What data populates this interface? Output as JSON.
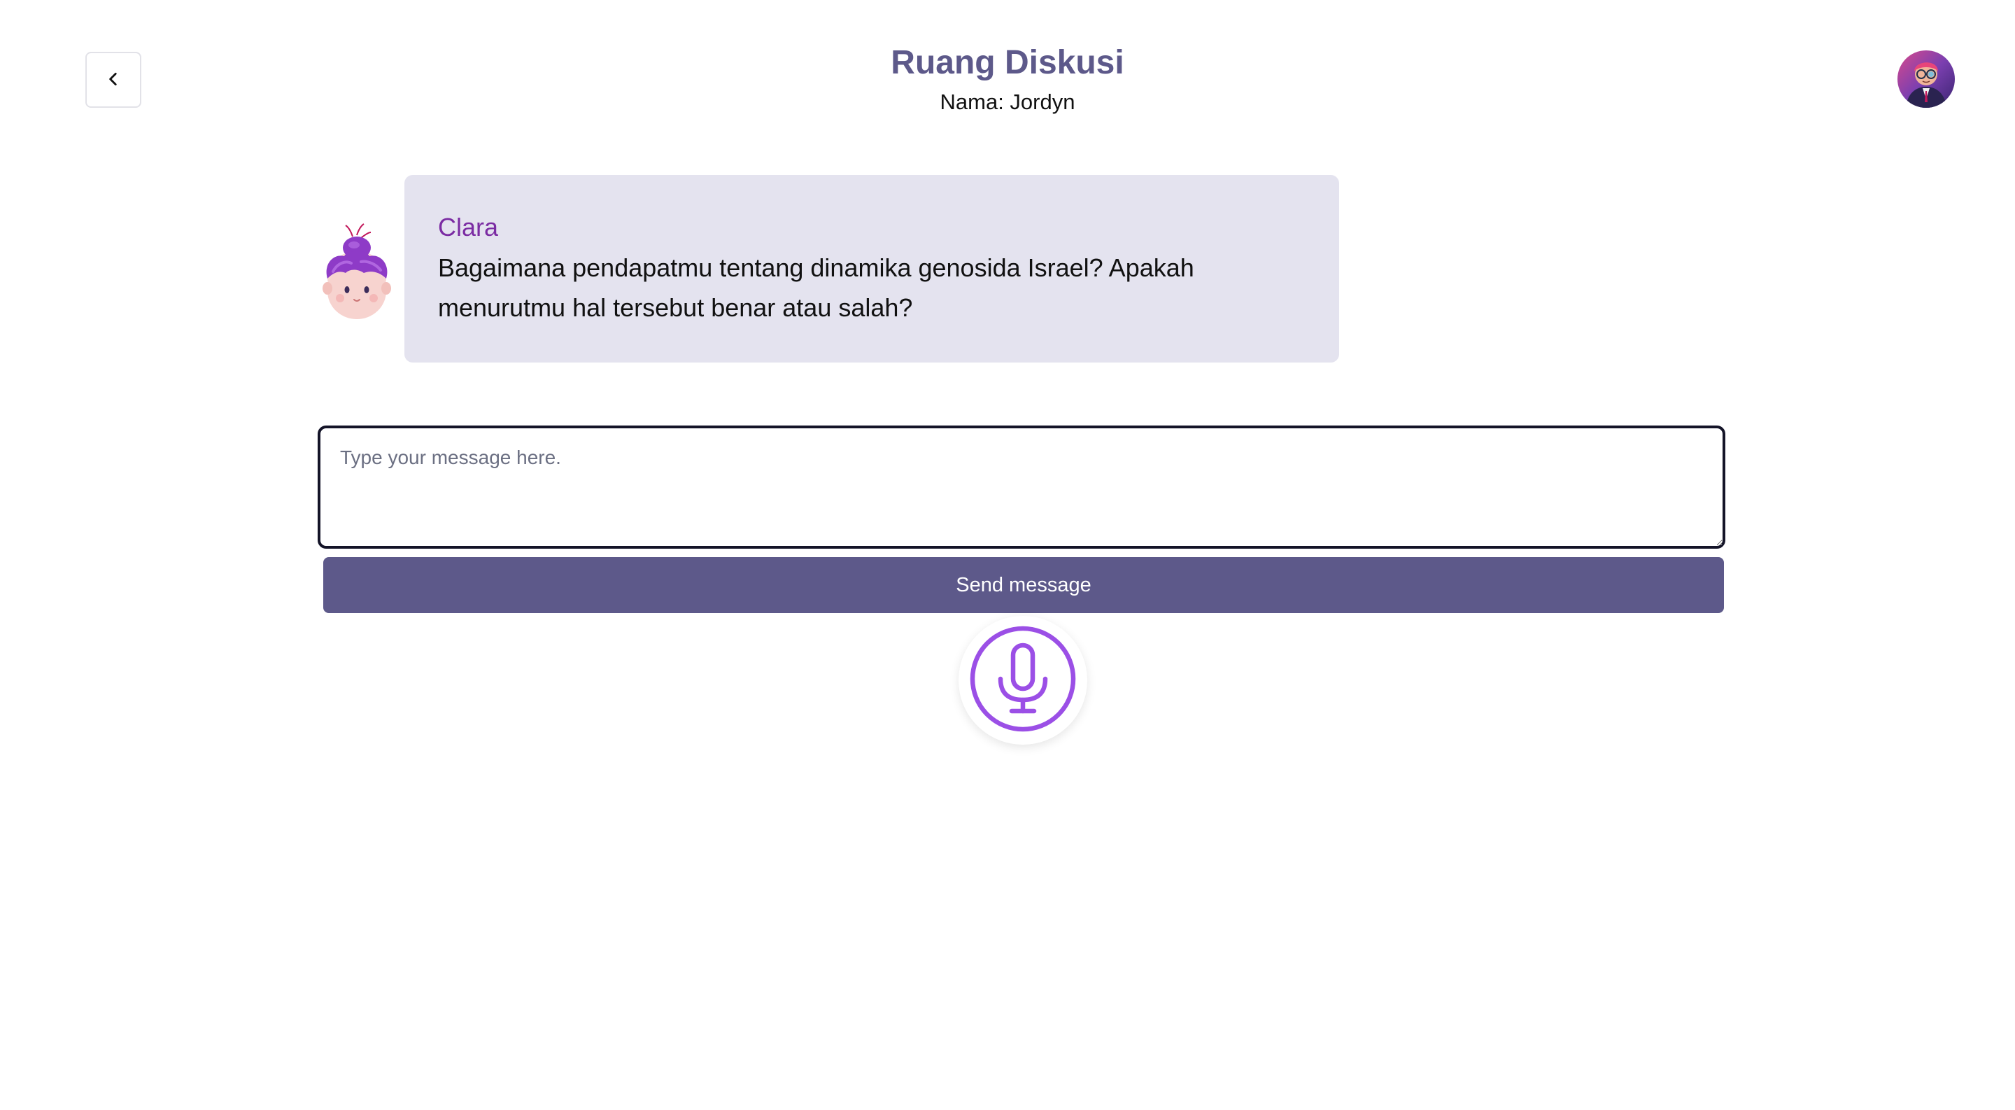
{
  "header": {
    "title": "Ruang Diskusi",
    "subtitle": "Nama: Jordyn"
  },
  "navigation": {
    "back_icon": "chevron-left-icon"
  },
  "user": {
    "avatar_icon": "user-avatar"
  },
  "conversation": {
    "messages": [
      {
        "sender": "Clara",
        "avatar_icon": "bot-avatar",
        "text": "Bagaimana pendapatmu tentang dinamika genosida Israel? Apakah menurutmu hal tersebut benar atau salah?"
      }
    ]
  },
  "composer": {
    "placeholder": "Type your message here.",
    "value": "",
    "send_label": "Send message",
    "mic_icon": "microphone-icon"
  },
  "colors": {
    "accent": "#5d598a",
    "bubble_bg": "#e4e3ef",
    "sender_name": "#7b2ca3",
    "mic": "#9b4fe6"
  }
}
